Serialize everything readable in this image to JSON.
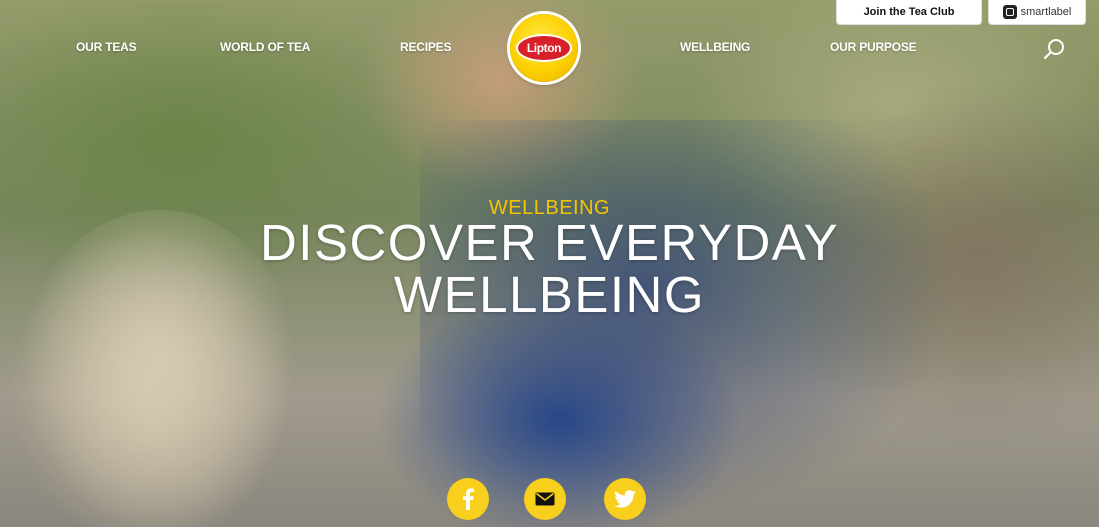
{
  "topbar": {
    "join_label": "Join the Tea Club",
    "smartlabel_label": "smartlabel"
  },
  "nav": {
    "items": [
      {
        "label": "OUR TEAS"
      },
      {
        "label": "WORLD OF TEA"
      },
      {
        "label": "RECIPES"
      },
      {
        "label": "WELLBEING"
      },
      {
        "label": "OUR PURPOSE"
      }
    ]
  },
  "logo": {
    "text": "Lipton"
  },
  "hero": {
    "kicker": "WELLBEING",
    "title_line1": "DISCOVER EVERYDAY",
    "title_line2": "WELLBEING"
  },
  "social": {
    "icons": [
      "facebook-icon",
      "email-icon",
      "twitter-icon"
    ]
  },
  "colors": {
    "brand_yellow": "#f7cf1c",
    "kicker_yellow": "#f5c400",
    "logo_red": "#d8202b"
  }
}
